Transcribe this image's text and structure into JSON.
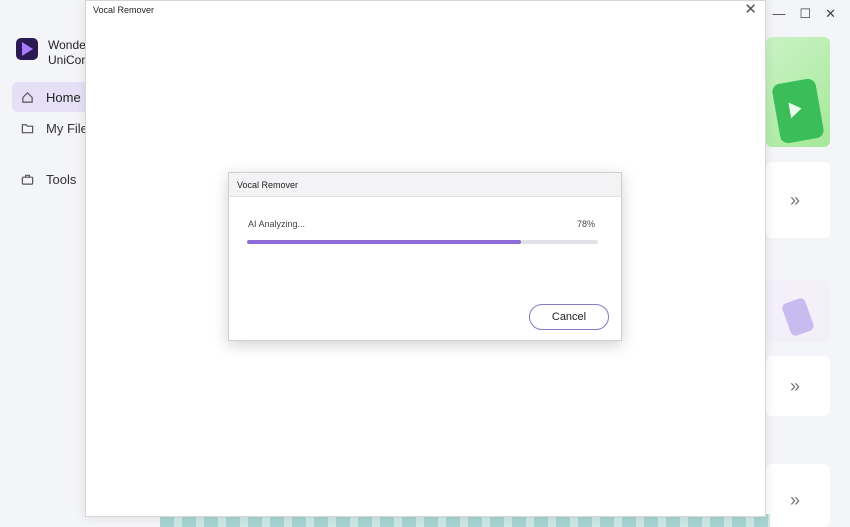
{
  "app": {
    "brand": "Wonder UniCon",
    "brand_line1": "Wonder",
    "brand_line2": "UniCon",
    "nav": [
      {
        "label": "Home",
        "icon": "home-icon",
        "active": true
      },
      {
        "label": "My File",
        "icon": "folder-icon"
      },
      {
        "label": "Tools",
        "icon": "toolbox-icon"
      }
    ],
    "window_controls": [
      "minimize-icon",
      "maximize-icon",
      "close-icon"
    ],
    "right_cards": {
      "chevron": "»"
    }
  },
  "vocal_window": {
    "title": "Vocal Remover",
    "close_glyph": "✕"
  },
  "dialog": {
    "title": "Vocal Remover",
    "status": "AI Analyzing...",
    "percent_label": "78%",
    "progress": 0.78,
    "cancel_label": "Cancel"
  },
  "colors": {
    "accent": "#8e6bd6",
    "nav_active_bg": "#e6e0f6",
    "green_card": "#a6e89a"
  }
}
